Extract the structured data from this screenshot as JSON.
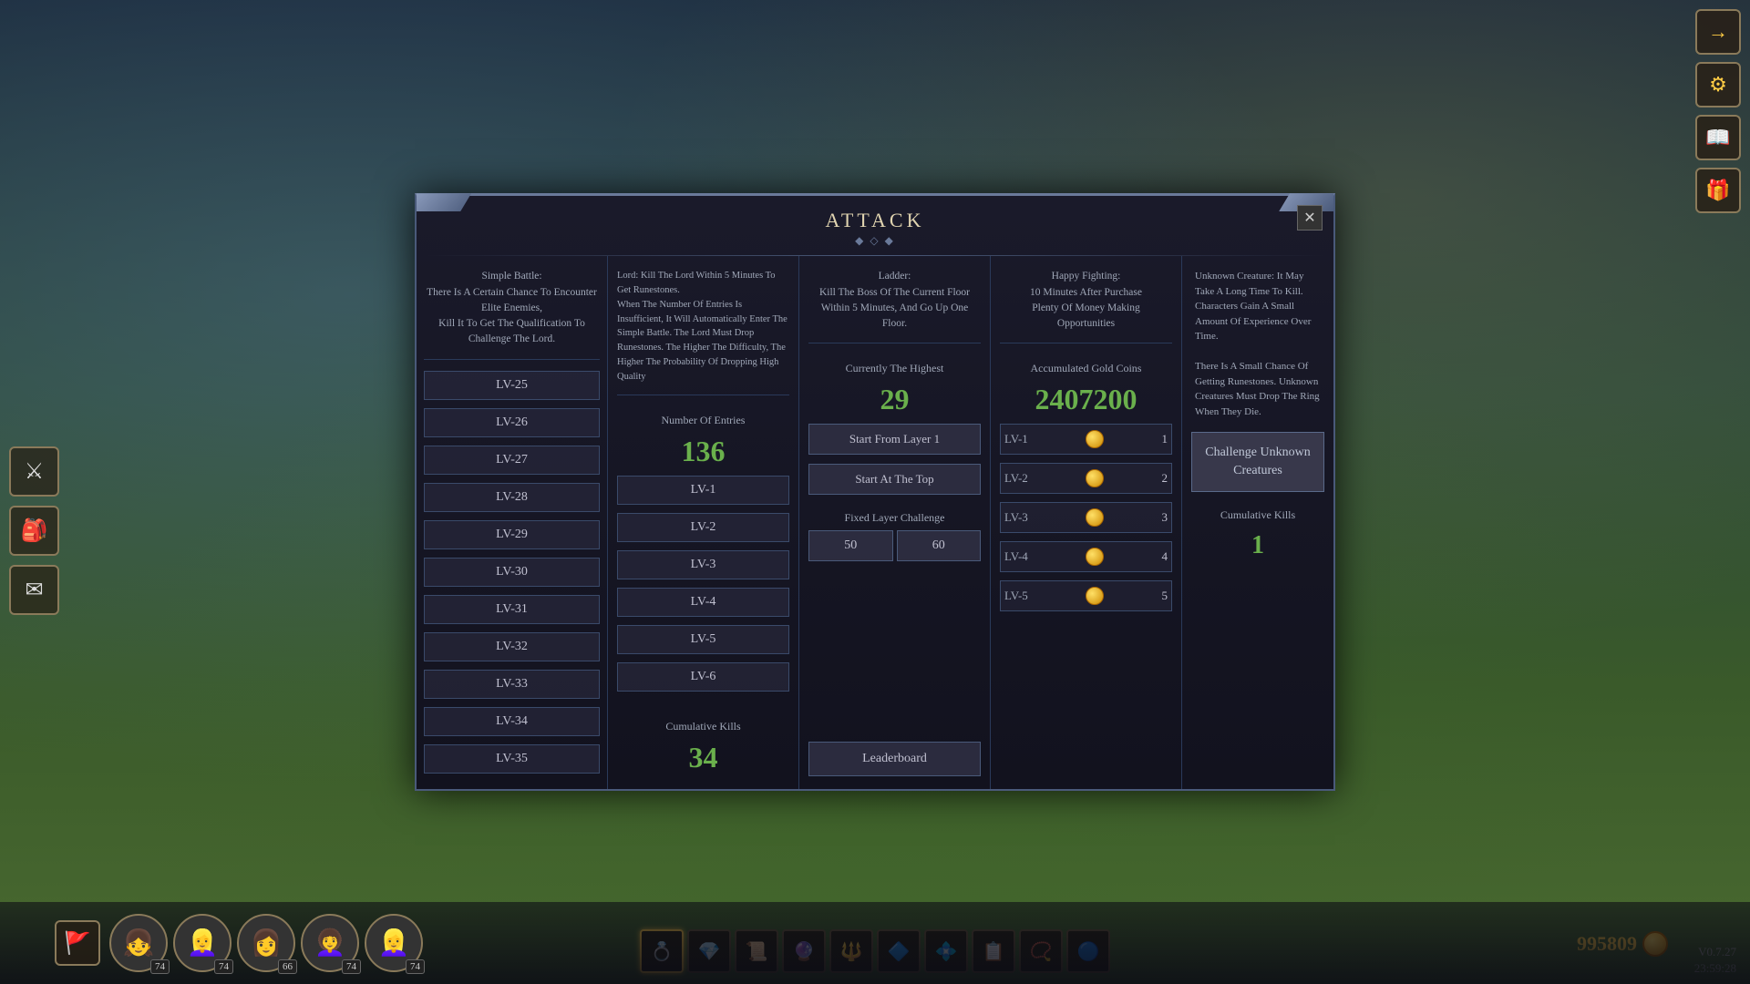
{
  "background": {
    "color": "#2a3a4a"
  },
  "modal": {
    "title": "ATTACK",
    "close_label": "✕",
    "col1": {
      "description": "Simple Battle:\nThere Is A Certain Chance To Encounter Elite Enemies,\nKill It To Get The Qualification To Challenge The Lord.",
      "levels": [
        "LV-25",
        "LV-26",
        "LV-27",
        "LV-28",
        "LV-29",
        "LV-30",
        "LV-31",
        "LV-32",
        "LV-33",
        "LV-34",
        "LV-35"
      ]
    },
    "col2": {
      "description": "Lord: Kill The Lord Within 5 Minutes To Get Runestones.\nWhen The Number Of Entries Is Insufficient, It Will Automatically Enter The Simple Battle. The Lord Must Drop Runestones. The Higher The Difficulty, The Higher The Probability Of Dropping High Quality",
      "number_of_entries_label": "Number Of Entries",
      "number_of_entries_value": "136",
      "entry_levels": [
        "LV-1",
        "LV-2",
        "LV-3",
        "LV-4",
        "LV-5",
        "LV-6"
      ],
      "cumulative_kills_label": "Cumulative Kills",
      "cumulative_kills_value": "34"
    },
    "col3": {
      "description": "Ladder:\nKill The Boss Of The Current Floor Within 5 Minutes, And Go Up One Floor.",
      "currently_highest_label": "Currently The Highest",
      "currently_highest_value": "29",
      "start_from_layer_label": "Start From Layer 1",
      "start_at_top_label": "Start At The Top",
      "fixed_layer_challenge_label": "Fixed Layer Challenge",
      "fixed_layer_val1": "50",
      "fixed_layer_val2": "60",
      "leaderboard_label": "Leaderboard"
    },
    "col4": {
      "description": "Happy Fighting:\n10 Minutes After Purchase\nPlenty Of Money Making\nOpportunities",
      "accumulated_gold_label": "Accumulated Gold Coins",
      "accumulated_gold_value": "2407200",
      "gold_rows": [
        {
          "level": "LV-1",
          "amount": 1
        },
        {
          "level": "LV-2",
          "amount": 2
        },
        {
          "level": "LV-3",
          "amount": 3
        },
        {
          "level": "LV-4",
          "amount": 4
        },
        {
          "level": "LV-5",
          "amount": 5
        }
      ]
    },
    "col5": {
      "description": "Unknown Creature: It May Take A Long Time To Kill. Characters Gain A Small Amount Of Experience Over Time.\nThere Is A Small Chance Of Getting Runestones. Unknown Creatures Must Drop The Ring When They Die.",
      "challenge_btn_label": "Challenge Unknown\nCreatures",
      "cumulative_kills_label": "Cumulative Kills",
      "cumulative_kills_value": "1"
    }
  },
  "right_icons": [
    {
      "name": "arrow-right-icon",
      "symbol": "→"
    },
    {
      "name": "gear-icon",
      "symbol": "⚙"
    },
    {
      "name": "book-icon",
      "symbol": "📖"
    },
    {
      "name": "gift-icon",
      "symbol": "🎁"
    }
  ],
  "left_icons": [
    {
      "name": "sword-icon",
      "symbol": "⚔"
    },
    {
      "name": "bag-icon",
      "symbol": "🎒"
    },
    {
      "name": "mail-icon",
      "symbol": "✉"
    },
    {
      "name": "flag-icon",
      "symbol": "🚩"
    }
  ],
  "avatars": [
    {
      "level": 74,
      "emoji": "👧"
    },
    {
      "level": 74,
      "emoji": "👱‍♀️"
    },
    {
      "level": 66,
      "emoji": "👩"
    },
    {
      "level": 74,
      "emoji": "👩‍🦱"
    },
    {
      "level": 74,
      "emoji": "👱‍♀️"
    }
  ],
  "equipment_slots": [
    {
      "name": "ring-slot",
      "emoji": "💍",
      "active": true
    },
    {
      "name": "gem-slot",
      "emoji": "💎"
    },
    {
      "name": "scroll-slot",
      "emoji": "📜"
    },
    {
      "name": "orb-slot",
      "emoji": "🔮"
    },
    {
      "name": "rune-slot",
      "emoji": "🔱"
    },
    {
      "name": "crystal-slot",
      "emoji": "🔷"
    },
    {
      "name": "shard-slot",
      "emoji": "💠"
    },
    {
      "name": "tablet-slot",
      "emoji": "📋"
    },
    {
      "name": "amulet-slot",
      "emoji": "📿"
    },
    {
      "name": "band-slot",
      "emoji": "🔵"
    }
  ],
  "currency": {
    "amount": "995809"
  },
  "version": {
    "text": "V0.7.27",
    "time": "23:59:28"
  }
}
